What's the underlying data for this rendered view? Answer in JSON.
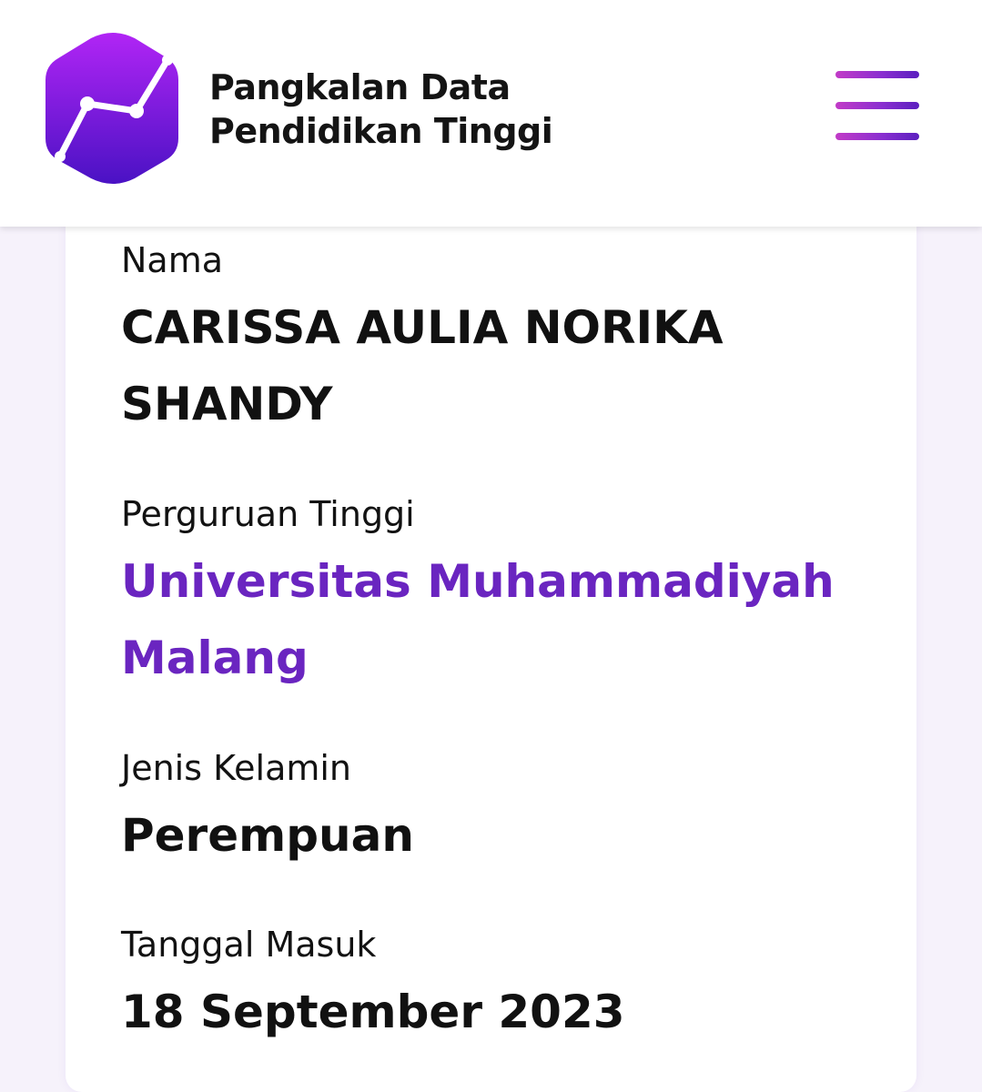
{
  "header": {
    "brand_line1": "Pangkalan Data",
    "brand_line2": "Pendidikan Tinggi",
    "logo_icon": "pddikti-logo-hexagon-chart-icon",
    "menu_icon": "hamburger-menu-icon"
  },
  "profile": {
    "nama_label": "Nama",
    "nama_value": "CARISSA AULIA NORIKA SHANDY",
    "pt_label": "Perguruan Tinggi",
    "pt_value": "Universitas Muhammadiyah Malang",
    "jk_label": "Jenis Kelamin",
    "jk_value": "Perempuan",
    "tm_label": "Tanggal Masuk",
    "tm_value": "18 September 2023"
  },
  "colors": {
    "accent": "#6a25c0",
    "logo_top": "#b125f5",
    "logo_bottom": "#4a12c4",
    "menu_gradient_start": "#c23bc7",
    "menu_gradient_end": "#5b1fbf",
    "background": "#f6f2fb"
  }
}
